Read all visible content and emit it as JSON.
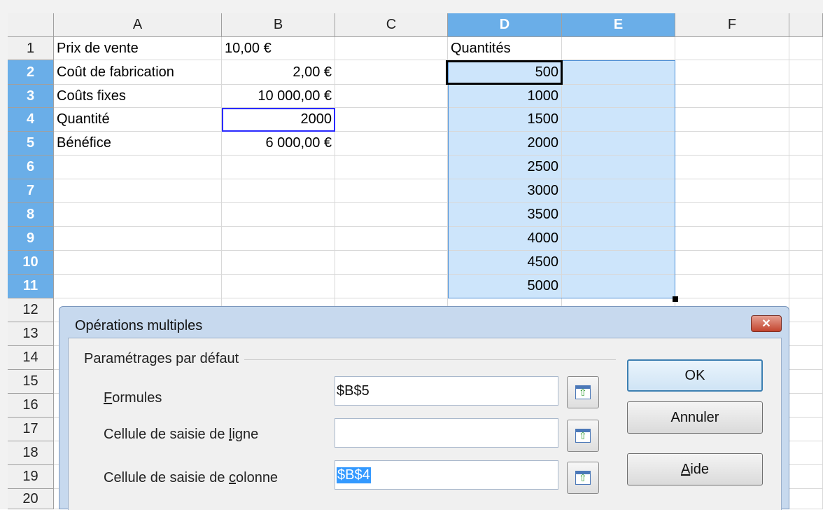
{
  "spreadsheet": {
    "columns": [
      "A",
      "B",
      "C",
      "D",
      "E",
      "F"
    ],
    "rows": [
      "1",
      "2",
      "3",
      "4",
      "5",
      "6",
      "7",
      "8",
      "9",
      "10",
      "11",
      "12",
      "13",
      "14",
      "15",
      "16",
      "17",
      "18",
      "19",
      "20"
    ],
    "cells": {
      "A1": "Prix de vente",
      "B1": "10,00 €",
      "D1": "Quantités",
      "A2": "Coût de fabrication",
      "B2": "2,00 €",
      "D2": "500",
      "A3": "Coûts fixes",
      "B3": "10 000,00 €",
      "D3": "1000",
      "A4": "Quantité",
      "B4": "2000",
      "D4": "1500",
      "A5": "Bénéfice",
      "B5": "6 000,00 €",
      "D5": "2000",
      "D6": "2500",
      "D7": "3000",
      "D8": "3500",
      "D9": "4000",
      "D10": "4500",
      "D11": "5000"
    },
    "selected_columns": [
      "D",
      "E"
    ],
    "selected_rows": [
      "2",
      "3",
      "4",
      "5",
      "6",
      "7",
      "8",
      "9",
      "10",
      "11"
    ],
    "selection_color": "#cde5fb",
    "header_selected_color": "#6aaee8"
  },
  "dialog": {
    "title": "Opérations multiples",
    "close_label": "✕",
    "group_label": "Paramétrages par défaut",
    "formulas": {
      "label_first": "F",
      "label_rest": "ormules",
      "value": "$B$5"
    },
    "row_input": {
      "label_before": "Cellule de saisie de ",
      "label_key": "l",
      "label_after": "igne",
      "value": ""
    },
    "col_input": {
      "label_before": "Cellule de saisie de ",
      "label_key": "c",
      "label_after": "olonne",
      "value": "$B$4"
    },
    "buttons": {
      "ok": "OK",
      "cancel": "Annuler",
      "help_key": "A",
      "help_rest": "ide"
    }
  }
}
